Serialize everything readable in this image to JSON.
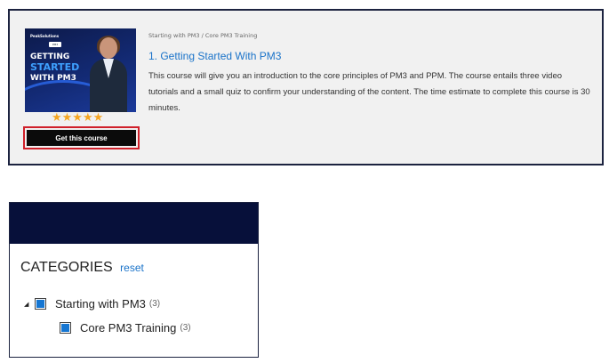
{
  "course": {
    "thumbnail": {
      "logo_text": "PeakSolutions",
      "badge_text": "PM3",
      "line1": "GETTING",
      "line2": "STARTED",
      "line3": "WITH PM3",
      "accent_color": "#3ea0ff"
    },
    "rating": {
      "stars": 5,
      "display": "★★★★★"
    },
    "get_course_label": "Get this course",
    "breadcrumb": "Starting with PM3 / Core PM3 Training",
    "title": "1. Getting Started With PM3",
    "description": "This course will give you an introduction to the core principles of PM3 and PPM. The course entails three video tutorials and a small quiz to confirm your understanding of the content. The time estimate to complete this course is 30 minutes."
  },
  "categories": {
    "title": "CATEGORIES",
    "reset_label": "reset",
    "items": [
      {
        "label": "Starting with PM3",
        "count": "(3)",
        "toggle": "◢",
        "checked": true,
        "children": [
          {
            "label": "Core PM3 Training",
            "count": "(3)",
            "checked": true
          }
        ]
      }
    ]
  },
  "colors": {
    "link": "#1a73c9",
    "header_bar": "#07103a",
    "checkbox_fill": "#1576d2",
    "star": "#f5a623",
    "button_border": "#d0202a"
  }
}
